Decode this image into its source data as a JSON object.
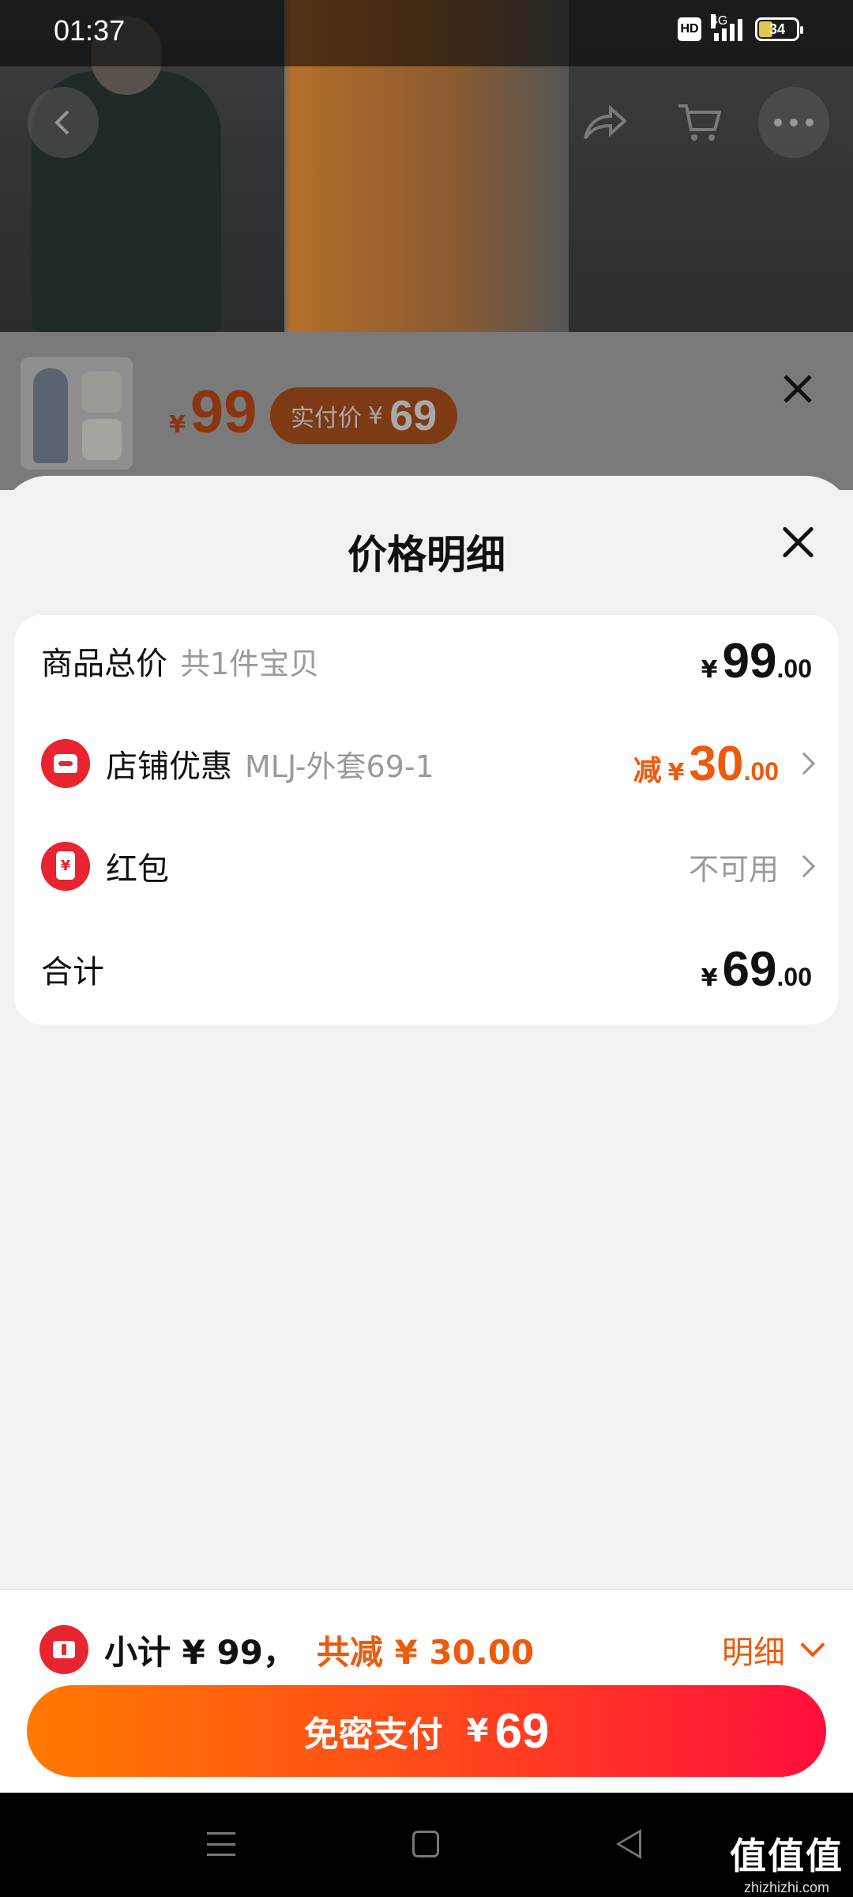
{
  "status_bar": {
    "time": "01:37",
    "hd_badge": "HD",
    "network": "4G",
    "battery": "34"
  },
  "product_header": {
    "icons": [
      "back-icon",
      "share-icon",
      "cart-icon",
      "more-icon"
    ]
  },
  "sku_panel": {
    "yen": "¥",
    "price": "99",
    "pill_label": "实付价",
    "pill_yen": "¥",
    "pill_price": "69",
    "close_icon": "×"
  },
  "sheet": {
    "title": "价格明细",
    "rows": {
      "total": {
        "label": "商品总价",
        "sub": "共1件宝贝",
        "yen": "¥",
        "int": "99",
        "dec": ".00"
      },
      "shop_discount": {
        "label": "店铺优惠",
        "sub": "MLJ-外套69-1",
        "minus": "减",
        "yen": "¥",
        "int": "30",
        "dec": ".00",
        "icon": "shop-icon"
      },
      "red_packet": {
        "label": "红包",
        "status": "不可用",
        "icon": "red-packet-icon"
      },
      "sum": {
        "label": "合计",
        "yen": "¥",
        "int": "69",
        "dec": ".00"
      }
    }
  },
  "bottom_bar": {
    "subtotal": "小计 ¥ 99，",
    "saving": "共减 ¥ 30.00",
    "detail": "明细",
    "pay_label": "免密支付",
    "pay_yen": "¥",
    "pay_amount": "69"
  },
  "watermark": {
    "main": "值值值",
    "sub": "zhizhizhi.com"
  },
  "colors": {
    "accent_orange": "#ee5a0d",
    "icon_red": "#e8242f",
    "pay_gradient_start": "#ff7a00",
    "pay_gradient_end": "#ff0f3c"
  }
}
